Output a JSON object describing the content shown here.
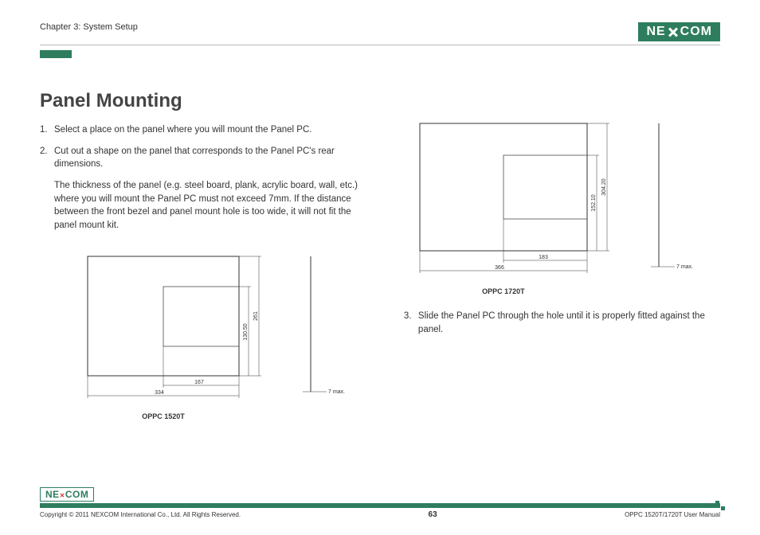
{
  "header": {
    "chapter": "Chapter 3: System Setup",
    "logo_text_1": "NE",
    "logo_text_2": "COM"
  },
  "title": "Panel Mounting",
  "steps": {
    "s1": {
      "num": "1.",
      "text": "Select a place on the panel where you will mount the Panel PC."
    },
    "s2": {
      "num": "2.",
      "text": "Cut out a shape on the panel that corresponds to the Panel PC's rear dimensions."
    },
    "s2_sub": "The thickness of the panel (e.g. steel board, plank, acrylic board, wall, etc.) where you will mount the Panel PC must not exceed 7mm. If the distance between the front bezel and panel mount hole is too wide, it will not fit the panel mount kit.",
    "s3": {
      "num": "3.",
      "text": "Slide the Panel PC through the hole until it is properly fitted against the panel."
    }
  },
  "diagram1": {
    "model": "OPPC 1520T",
    "dims": {
      "w_outer": "334",
      "w_inner": "167",
      "h_outer": "261",
      "h_inner": "130.50",
      "thickness": "7 max."
    }
  },
  "diagram2": {
    "model": "OPPC 1720T",
    "dims": {
      "w_outer": "366",
      "w_inner": "183",
      "h_outer": "304.20",
      "h_inner": "152.10",
      "thickness": "7 max."
    }
  },
  "footer": {
    "copyright": "Copyright © 2011 NEXCOM International Co., Ltd. All Rights Reserved.",
    "page": "63",
    "manual": "OPPC 1520T/1720T User Manual",
    "logo": "NE COM"
  }
}
